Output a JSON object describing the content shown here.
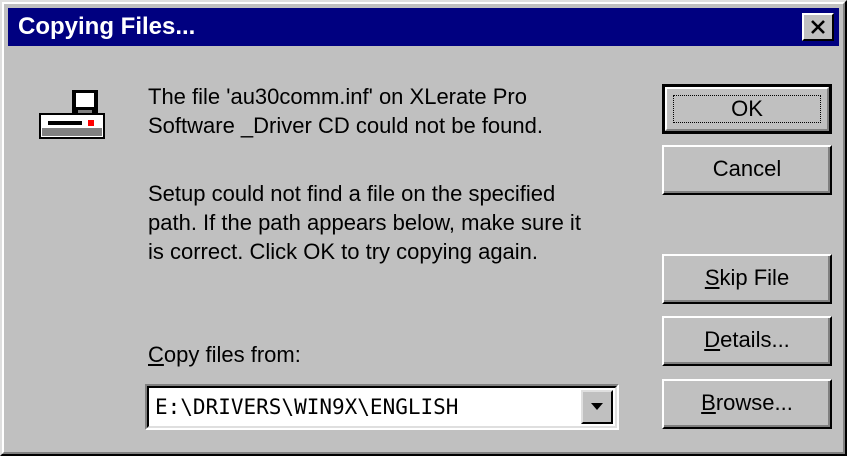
{
  "window": {
    "title": "Copying Files..."
  },
  "icons": {
    "title_close": "close-icon",
    "main": "floppy-disk-drive-icon",
    "dropdown": "chevron-down-icon"
  },
  "message": {
    "line1": "The file 'au30comm.inf' on XLerate Pro",
    "line2": "Software _Driver CD could not be found.",
    "line3": "Setup could not find a file on the specified",
    "line4": "path. If the path appears below, make sure it",
    "line5": "is correct. Click OK to try copying again."
  },
  "copy_from": {
    "label_hotkey": "C",
    "label_rest": "opy files from:",
    "value": "E:\\DRIVERS\\WIN9X\\ENGLISH"
  },
  "buttons": {
    "ok": "OK",
    "cancel": "Cancel",
    "skip_hotkey": "S",
    "skip_rest": "kip File",
    "details_hotkey": "D",
    "details_rest": "etails...",
    "browse_hotkey": "B",
    "browse_rest": "rowse..."
  },
  "colors": {
    "face": "#c0c0c0",
    "titlebar": "#000080",
    "title_text": "#ffffff"
  }
}
